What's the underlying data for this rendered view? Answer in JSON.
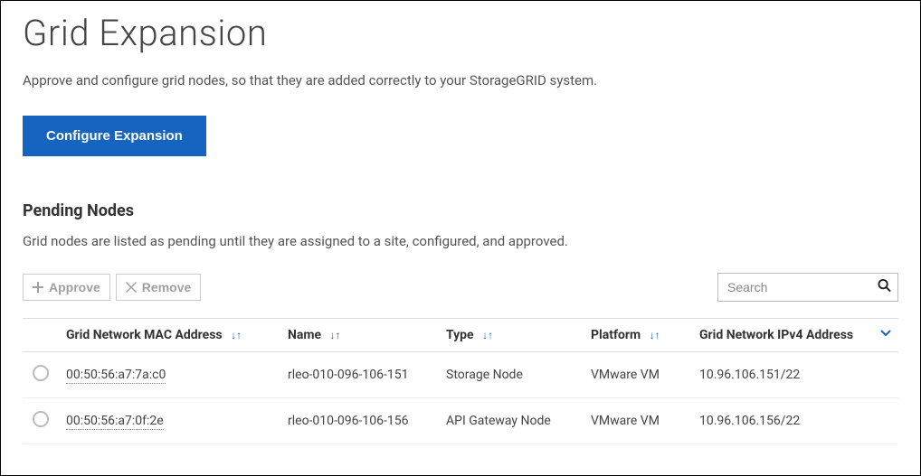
{
  "page": {
    "title": "Grid Expansion",
    "description": "Approve and configure grid nodes, so that they are added correctly to your StorageGRID system."
  },
  "buttons": {
    "configure": "Configure Expansion",
    "approve": "Approve",
    "remove": "Remove"
  },
  "pending": {
    "title": "Pending Nodes",
    "description": "Grid nodes are listed as pending until they are assigned to a site, configured, and approved."
  },
  "search": {
    "placeholder": "Search"
  },
  "table": {
    "headers": {
      "mac": "Grid Network MAC Address",
      "name": "Name",
      "type": "Type",
      "platform": "Platform",
      "ip": "Grid Network IPv4 Address"
    },
    "rows": [
      {
        "mac": "00:50:56:a7:7a:c0",
        "name": "rleo-010-096-106-151",
        "type": "Storage Node",
        "platform": "VMware VM",
        "ip": "10.96.106.151/22"
      },
      {
        "mac": "00:50:56:a7:0f:2e",
        "name": "rleo-010-096-106-156",
        "type": "API Gateway Node",
        "platform": "VMware VM",
        "ip": "10.96.106.156/22"
      }
    ]
  }
}
